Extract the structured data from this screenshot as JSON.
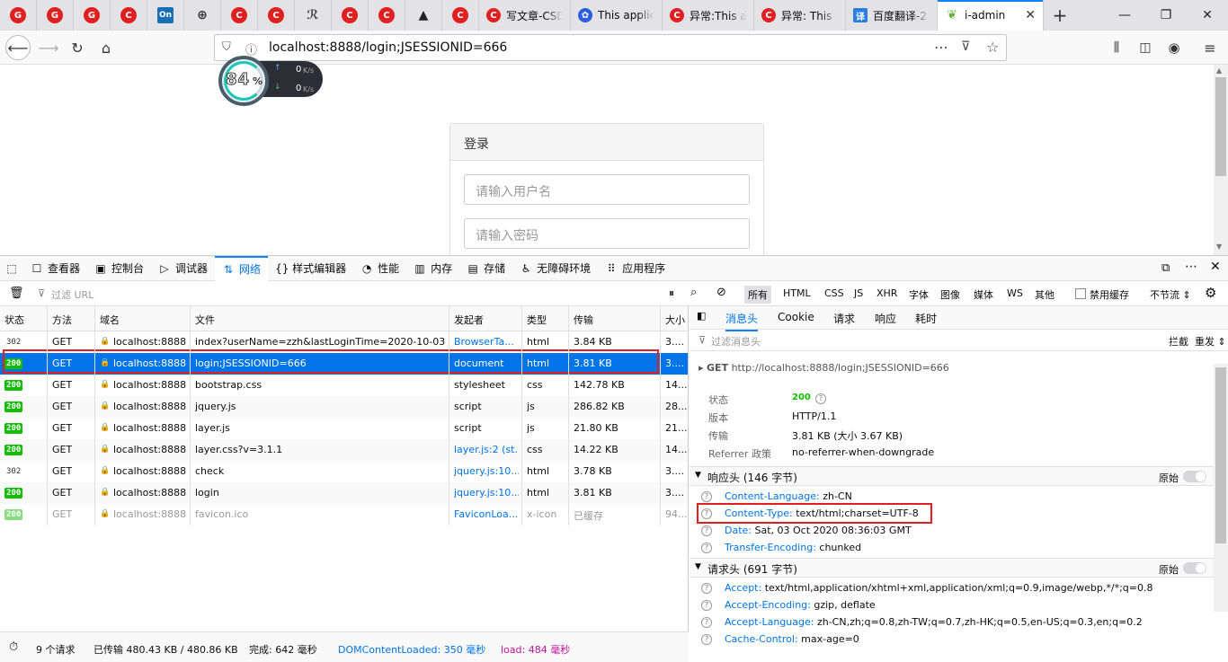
{
  "tabs": {
    "icon_tabs": [
      {
        "icon": "g-icon",
        "glyph": "G",
        "color": "#e02020"
      },
      {
        "icon": "g-icon",
        "glyph": "G",
        "color": "#e02020"
      },
      {
        "icon": "g-icon",
        "glyph": "G",
        "color": "#e02020"
      },
      {
        "icon": "csdn-icon",
        "glyph": "C",
        "color": "#e02020"
      },
      {
        "icon": "on-icon",
        "glyph": "On",
        "color": "#1a6fb3"
      },
      {
        "icon": "globe-icon",
        "glyph": "⊕",
        "color": "#333333"
      },
      {
        "icon": "csdn-icon",
        "glyph": "C",
        "color": "#e02020"
      },
      {
        "icon": "csdn-icon",
        "glyph": "C",
        "color": "#e02020"
      },
      {
        "icon": "script-icon",
        "glyph": "ℛ",
        "color": "#444444"
      },
      {
        "icon": "csdn-icon",
        "glyph": "C",
        "color": "#e02020"
      },
      {
        "icon": "csdn-icon",
        "glyph": "C",
        "color": "#e02020"
      },
      {
        "icon": "warning-icon",
        "glyph": "▲",
        "color": "#222222"
      },
      {
        "icon": "csdn-icon",
        "glyph": "C",
        "color": "#e02020"
      }
    ],
    "text_tabs": [
      {
        "title": "写文章-CSDN",
        "icon": "csdn-icon",
        "glyph": "C",
        "color": "#e02020"
      },
      {
        "title": "This applic",
        "icon": "baidu-paw-icon",
        "glyph": "✿",
        "color": "#2c5fe0"
      },
      {
        "title": "异常:This a",
        "icon": "csdn-icon",
        "glyph": "C",
        "color": "#e02020"
      },
      {
        "title": "异常: This",
        "icon": "csdn-icon",
        "glyph": "C",
        "color": "#e02020"
      },
      {
        "title": "百度翻译-2",
        "icon": "translate-icon",
        "glyph": "译",
        "color": "#2a7de1"
      }
    ],
    "active_tab": {
      "title": "i-admin",
      "icon": "spring-leaf-icon",
      "glyph": "❦",
      "color": "#6db33f"
    }
  },
  "navbar": {
    "url": "localhost:8888/login;JSESSIONID=666"
  },
  "speed_widget": {
    "percent": "84",
    "percent_sign": "%",
    "up": "0",
    "down": "0",
    "unit": "K/s"
  },
  "login": {
    "title": "登录",
    "username_placeholder": "请输入用户名",
    "password_placeholder": "请输入密码"
  },
  "devtools": {
    "tabs": [
      {
        "label": "查看器",
        "icon": "inspector-icon",
        "glyph": "☐"
      },
      {
        "label": "控制台",
        "icon": "console-icon",
        "glyph": "▣"
      },
      {
        "label": "调试器",
        "icon": "debugger-icon",
        "glyph": "▷"
      },
      {
        "label": "网络",
        "icon": "network-icon",
        "glyph": "⇅"
      },
      {
        "label": "样式编辑器",
        "icon": "style-editor-icon",
        "glyph": "{}"
      },
      {
        "label": "性能",
        "icon": "performance-icon",
        "glyph": "◔"
      },
      {
        "label": "内存",
        "icon": "memory-icon",
        "glyph": "▥"
      },
      {
        "label": "存储",
        "icon": "storage-icon",
        "glyph": "▤"
      },
      {
        "label": "无障碍环境",
        "icon": "accessibility-icon",
        "glyph": "♿"
      },
      {
        "label": "应用程序",
        "icon": "application-icon",
        "glyph": "⠿"
      }
    ],
    "filter_placeholder": "过滤 URL",
    "type_filters": [
      "所有",
      "HTML",
      "CSS",
      "JS",
      "XHR",
      "字体",
      "图像",
      "媒体",
      "WS",
      "其他"
    ],
    "disable_cache": "禁用缓存",
    "throttle": "不节流 ⇕",
    "columns": [
      "状态",
      "方法",
      "域名",
      "文件",
      "发起者",
      "类型",
      "传输",
      "大小"
    ],
    "requests": [
      {
        "status": "302",
        "method": "GET",
        "domain": "localhost:8888",
        "file": "index?userName=zzh&lastLoginTime=2020-10-03",
        "initiator": "BrowserTa...",
        "type": "html",
        "transfer": "3.84 KB",
        "size": "3...."
      },
      {
        "status": "200",
        "method": "GET",
        "domain": "localhost:8888",
        "file": "login;JSESSIONID=666",
        "initiator": "document",
        "type": "html",
        "transfer": "3.81 KB",
        "size": "3...."
      },
      {
        "status": "200",
        "method": "GET",
        "domain": "localhost:8888",
        "file": "bootstrap.css",
        "initiator": "stylesheet",
        "type": "css",
        "transfer": "142.78 KB",
        "size": "14..."
      },
      {
        "status": "200",
        "method": "GET",
        "domain": "localhost:8888",
        "file": "jquery.js",
        "initiator": "script",
        "type": "js",
        "transfer": "286.82 KB",
        "size": "28..."
      },
      {
        "status": "200",
        "method": "GET",
        "domain": "localhost:8888",
        "file": "layer.js",
        "initiator": "script",
        "type": "js",
        "transfer": "21.80 KB",
        "size": "21..."
      },
      {
        "status": "200",
        "method": "GET",
        "domain": "localhost:8888",
        "file": "layer.css?v=3.1.1",
        "initiator": "layer.js:2 (st...",
        "type": "css",
        "transfer": "14.22 KB",
        "size": "14..."
      },
      {
        "status": "302",
        "method": "GET",
        "domain": "localhost:8888",
        "file": "check",
        "initiator": "jquery.js:10...",
        "type": "html",
        "transfer": "3.78 KB",
        "size": "3...."
      },
      {
        "status": "200",
        "method": "GET",
        "domain": "localhost:8888",
        "file": "login",
        "initiator": "jquery.js:10...",
        "type": "html",
        "transfer": "3.81 KB",
        "size": "3...."
      },
      {
        "status": "200",
        "method": "GET",
        "domain": "localhost:8888",
        "file": "favicon.ico",
        "initiator": "FaviconLoa...",
        "type": "x-icon",
        "transfer": "已缓存",
        "size": "94..."
      }
    ],
    "statusbar": {
      "requests": "9 个请求",
      "transferred": "已传输 480.43 KB / 480.86 KB",
      "finish": "完成: 642 毫秒",
      "dcl": "DOMContentLoaded: 350 毫秒",
      "load": "load: 484 毫秒"
    },
    "side": {
      "tabs": [
        "消息头",
        "Cookie",
        "请求",
        "响应",
        "耗时"
      ],
      "filter_placeholder": "过滤消息头",
      "block_label": "拦截",
      "resend_label": "重发 ⇕",
      "request_line_method": "GET",
      "request_line_url": "http://localhost:8888/login;JSESSIONID=666",
      "summary": [
        {
          "key": "状态",
          "value": "200"
        },
        {
          "key": "版本",
          "value": "HTTP/1.1"
        },
        {
          "key": "传输",
          "value": "3.81 KB (大小 3.67 KB)"
        },
        {
          "key": "Referrer 政策",
          "value": "no-referrer-when-downgrade"
        }
      ],
      "response_section": "响应头 (146 字节)",
      "raw_label": "原始",
      "response_headers": [
        {
          "name": "Content-Language:",
          "value": "zh-CN"
        },
        {
          "name": "Content-Type:",
          "value": "text/html;charset=UTF-8"
        },
        {
          "name": "Date:",
          "value": "Sat, 03 Oct 2020 08:36:03 GMT"
        },
        {
          "name": "Transfer-Encoding:",
          "value": "chunked"
        }
      ],
      "request_section": "请求头 (691 字节)",
      "request_headers": [
        {
          "name": "Accept:",
          "value": "text/html,application/xhtml+xml,application/xml;q=0.9,image/webp,*/*;q=0.8"
        },
        {
          "name": "Accept-Encoding:",
          "value": "gzip, deflate"
        },
        {
          "name": "Accept-Language:",
          "value": "zh-CN,zh;q=0.8,zh-TW;q=0.7,zh-HK;q=0.5,en-US;q=0.3,en;q=0.2"
        },
        {
          "name": "Cache-Control:",
          "value": "max-age=0"
        }
      ]
    }
  },
  "colors": {
    "accent": "#0a84ff",
    "selected_row": "#0074e8",
    "status_ok": "#12bc00",
    "highlight_box": "#e02020",
    "load": "#c0129b",
    "dcl": "#0074e8"
  }
}
